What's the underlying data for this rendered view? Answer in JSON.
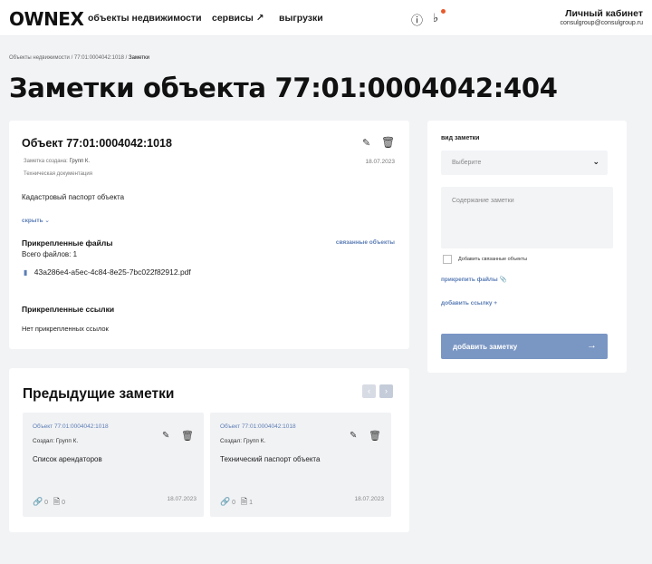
{
  "header": {
    "logo": "OWNEX",
    "nav": [
      "объекты недвижимости",
      "сервисы ↗",
      "выгрузки"
    ],
    "help_icon": "help-icon",
    "bell_icon": "bell-icon",
    "account_title": "Личный кабинет",
    "account_email": "consulgroup@consulgroup.ru"
  },
  "breadcrumb": {
    "item1": "Объекты недвижимости",
    "sep": "/",
    "item2": "77:01:0004042:1018",
    "item3": "Заметки"
  },
  "page_title": "Заметки объекта 77:01:0004042:404",
  "note": {
    "title": "Объект 77:01:0004042:1018",
    "created_label": "Заметка создана:",
    "created_by": "Групп К.",
    "date": "18.07.2023",
    "type": "Техническая документация",
    "body": "Кадастровый паспорт объекта",
    "hide_label": "скрыть",
    "files_heading": "Прикрепленные файлы",
    "linked_objects": "связанные объекты",
    "files_count": "Всего файлов: 1",
    "file_name": "43a286e4-a5ec-4c84-8e25-7bc022f82912.pdf",
    "links_heading": "Прикрепленные ссылки",
    "links_value": "Нет прикрепленных ссылок"
  },
  "form": {
    "type_label": "вид заметки",
    "type_placeholder": "Выберите",
    "content_placeholder": "Содержание заметки",
    "checkbox_label": "Добавить связанные объекты",
    "attach_label": "прикрепить файлы",
    "add_link_label": "добавить ссылку",
    "submit_label": "добавить заметку",
    "submit_arrow": "→"
  },
  "previous": {
    "heading": "Предыдущие заметки",
    "prev_arrow": "‹",
    "next_arrow": "›",
    "items": [
      {
        "title": "Объект 77:01:0004042:1018",
        "by": "Создал: Групп К.",
        "body": "Список арендаторов",
        "links": "0",
        "files": "0",
        "date": "18.07.2023"
      },
      {
        "title": "Объект 77:01:0004042:1018",
        "by": "Создал: Групп К.",
        "body": "Технический паспорт объекта",
        "links": "0",
        "files": "1",
        "date": "18.07.2023"
      }
    ]
  },
  "colors": {
    "accent": "#5b7db5",
    "button": "#7a96c3",
    "notification": "#e85a2b"
  }
}
